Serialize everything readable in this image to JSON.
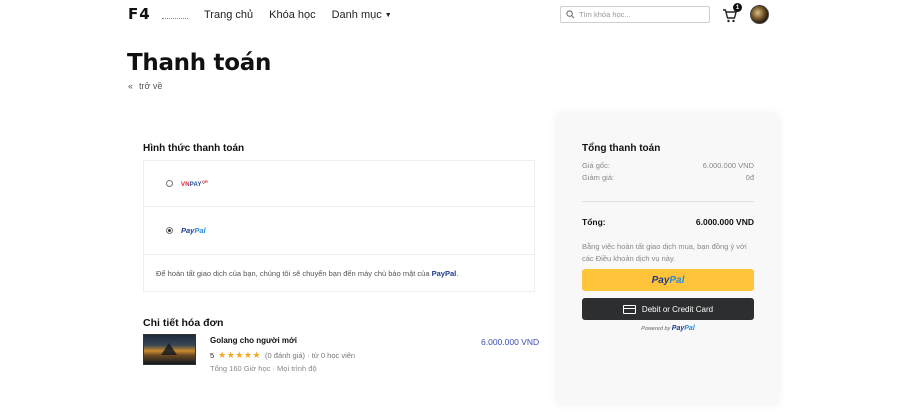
{
  "header": {
    "logo": "F4",
    "nav": [
      {
        "label": "Trang chủ"
      },
      {
        "label": "Khóa học"
      },
      {
        "label": "Danh mục"
      }
    ],
    "search_placeholder": "Tìm khóa học...",
    "cart_count": "1"
  },
  "page": {
    "title": "Thanh toán",
    "back_label": "trở về"
  },
  "payment": {
    "heading": "Hình thức thanh toán",
    "methods": [
      {
        "name": "VNPAY",
        "selected": false
      },
      {
        "name": "PayPal",
        "selected": true
      }
    ],
    "vnpay_vn": "VN",
    "vnpay_pay": "PAY",
    "vnpay_sup": "QR",
    "paypal_pay": "Pay",
    "paypal_pal": "Pal",
    "note_prefix": "Để hoàn tất giao dịch của bạn, chúng tôi sẽ chuyển bạn đến máy chủ bảo mật của",
    "note_brand": "PayPal",
    "note_suffix": "."
  },
  "invoice": {
    "heading": "Chi tiết hóa đơn",
    "items": [
      {
        "name": "Golang cho người mới",
        "rating": "5",
        "stars": "★★★★★",
        "reviews": "(0 đánh giá) · từ 0 học viên",
        "meta": "Tổng 160 Giờ học  ·  Mọi trình độ",
        "price": "6.000.000 VND"
      }
    ]
  },
  "summary": {
    "title": "Tổng thanh toán",
    "original_label": "Giá gốc:",
    "original_value": "6.000.000 VND",
    "discount_label": "Giảm giá:",
    "discount_value": "0đ",
    "total_label": "Tổng:",
    "total_value": "6.000.000 VND",
    "terms": "Bằng việc hoàn tất giao dịch mua, bạn đồng ý với các Điều khoản dịch vụ này.",
    "paypal_btn_pay": "Pay",
    "paypal_btn_pal": "Pal",
    "card_btn": "Debit or Credit Card",
    "powered_by": "Powered by",
    "powered_pay": "Pay",
    "powered_pal": "Pal"
  },
  "colors": {
    "paypal_yellow": "#ffc439",
    "paypal_dark_blue": "#1d3b8c",
    "paypal_light_blue": "#2a8bd6",
    "price_blue": "#3b4db8",
    "card_button": "#2c2e2f",
    "star": "#f5a623"
  }
}
